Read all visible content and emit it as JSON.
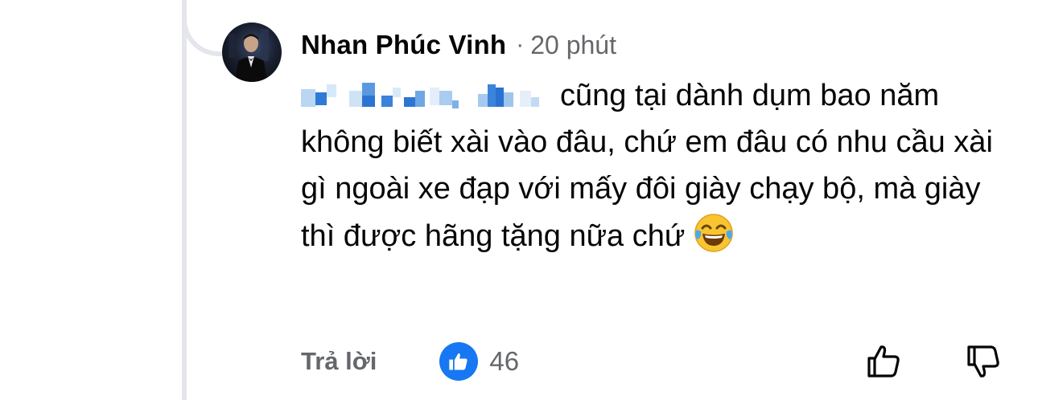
{
  "comment": {
    "author": "Nhan Phúc Vinh",
    "separator": "·",
    "time": "20 phút",
    "text_line1": "cũng tại dành dụm bao",
    "text_rest": "năm không biết xài vào đâu, chứ em đâu có nhu cầu xài gì ngoài xe đạp với mấy đôi giày chạy bộ, mà giày thì được hãng tặng nữa chứ",
    "emoji": "laughing-tears-emoji"
  },
  "actions": {
    "reply_label": "Trả lời",
    "like_count": "46",
    "reaction_icon": "thumbs-up-icon",
    "upvote_icon": "thumbs-up-outline-icon",
    "downvote_icon": "thumbs-down-outline-icon"
  },
  "colors": {
    "text": "#050505",
    "muted": "#65676b",
    "like_blue": "#1877f2",
    "thread_line": "#e4e6eb"
  }
}
